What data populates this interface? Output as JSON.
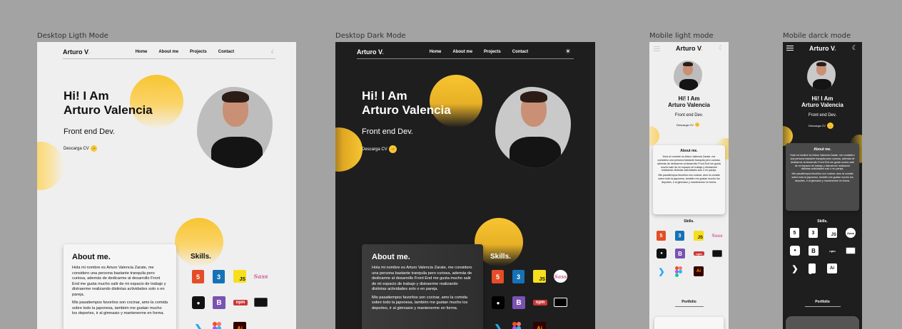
{
  "labels": {
    "desktop_light": "Desktop Ligth Mode",
    "desktop_dark": "Desktop Dark Mode",
    "mobile_light": "Mobile light mode",
    "mobile_dark": "Mobile darck mode"
  },
  "site": {
    "logo": "Arturo V",
    "logo_dot": ".",
    "nav": [
      "Home",
      "About me",
      "Projects",
      "Contact"
    ],
    "hero_line1": "Hi! I Am",
    "hero_line2": "Arturo Valencia",
    "subtitle": "Front end Dev.",
    "cv_label": "Descarga CV",
    "cv_arrow": "→",
    "about_title": "About me.",
    "about_p1": "Hola mi nombre es Arturo Valencia Zarate, me considero una persona bastante tranquila pero curiosa, además de dedicarme al desarrollo Front End me gusta mucho salir de mi espacio de trabajo y distraerme realizando distintas actividades solo o en pareja.",
    "about_p2": "Mis pasatiempos favoritos son cocinar, amo la comida sobre todo la japonesa, también me gustan mucho los deportes, ir al gimnasio y mantenerme en forma.",
    "skills_title": "Skills.",
    "skills": {
      "html": "5",
      "css": "3",
      "js": "JS",
      "sass": "Sass",
      "bootstrap": "B",
      "npm": "npm",
      "terminal": "",
      "vscode": "❯",
      "ai": "Ai",
      "github": "●"
    },
    "portfolio": "Portfolio",
    "theme_icon_light": "☾",
    "theme_icon_dark": "☀"
  },
  "colors": {
    "accent": "#f7c531",
    "light_bg": "#efefef",
    "dark_bg": "#1e1e1e",
    "canvas_bg": "#a3a3a3"
  }
}
